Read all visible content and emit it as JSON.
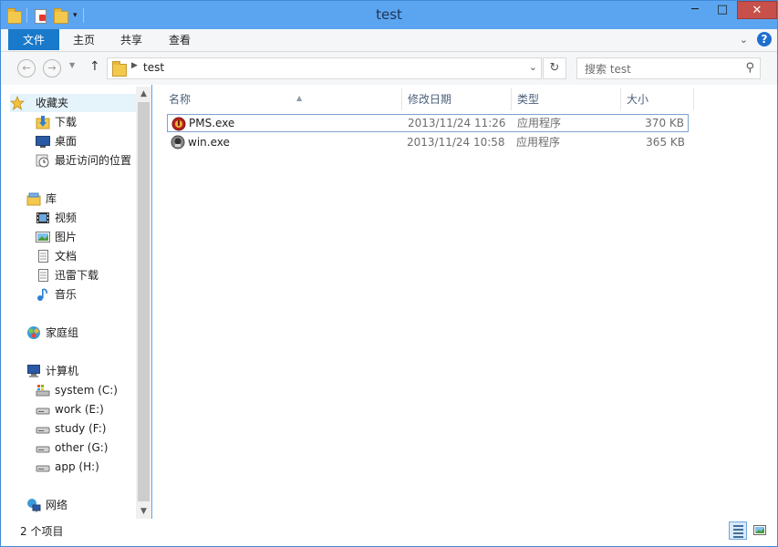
{
  "window": {
    "title": "test"
  },
  "quick_access": [
    "folder-icon",
    "properties-icon",
    "new-folder-icon"
  ],
  "ribbon": {
    "tabs": [
      "文件",
      "主页",
      "共享",
      "查看"
    ]
  },
  "address": {
    "path": "test"
  },
  "search": {
    "placeholder": "搜索 test"
  },
  "nav_pane": {
    "favorites": {
      "label": "收藏夹",
      "items": [
        "下载",
        "桌面",
        "最近访问的位置"
      ]
    },
    "libraries": {
      "label": "库",
      "items": [
        "视频",
        "图片",
        "文档",
        "迅雷下载",
        "音乐"
      ]
    },
    "homegroup": {
      "label": "家庭组"
    },
    "computer": {
      "label": "计算机",
      "items": [
        "system (C:)",
        "work (E:)",
        "study (F:)",
        "other (G:)",
        "app (H:)"
      ]
    },
    "network": {
      "label": "网络"
    }
  },
  "columns": {
    "name": "名称",
    "date": "修改日期",
    "type": "类型",
    "size": "大小"
  },
  "files": [
    {
      "name": "PMS.exe",
      "date": "2013/11/24 11:26",
      "type": "应用程序",
      "size": "370 KB",
      "icon": "pms-app-icon"
    },
    {
      "name": "win.exe",
      "date": "2013/11/24 10:58",
      "type": "应用程序",
      "size": "365 KB",
      "icon": "win-app-icon"
    }
  ],
  "status": {
    "item_count": "2 个项目"
  },
  "colors": {
    "title_bar": "#5ba5f0",
    "file_tab": "#1979ca",
    "close_button": "#c7504a",
    "selection": "#e5f3fb"
  }
}
